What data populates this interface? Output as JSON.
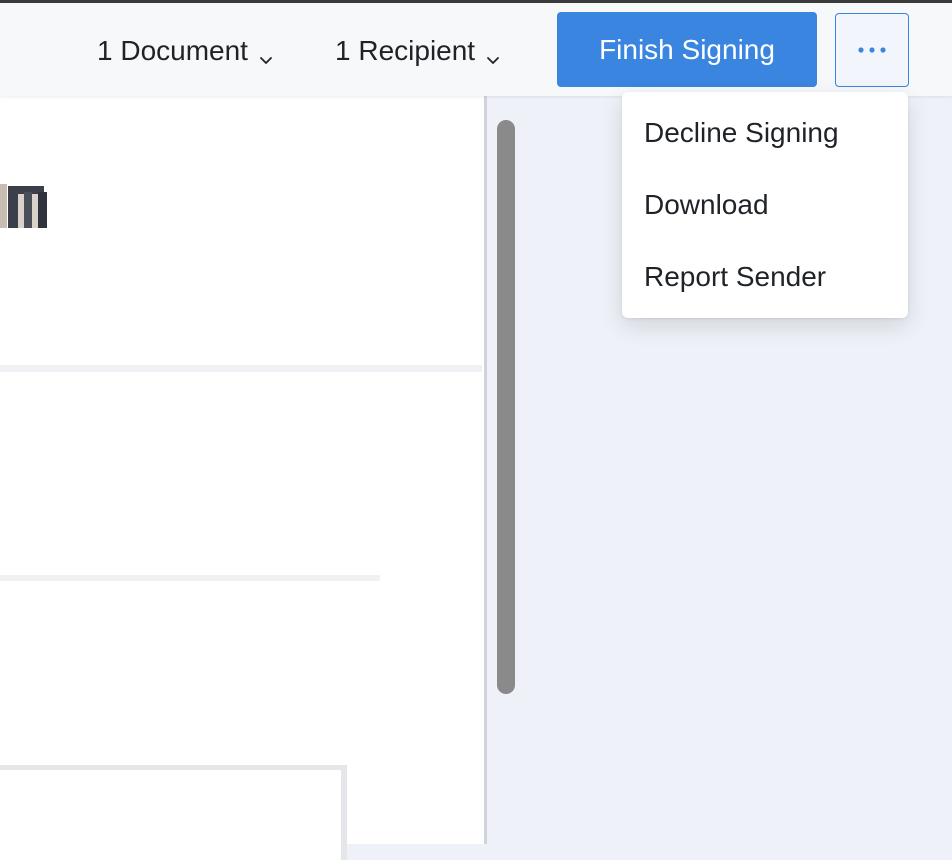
{
  "header": {
    "documents_label": "1 Document",
    "recipients_label": "1 Recipient",
    "finish_label": "Finish Signing",
    "more_icon": "ellipsis-icon",
    "chevron_icon": "chevron-down-icon"
  },
  "menu": {
    "items": [
      {
        "label": "Decline Signing"
      },
      {
        "label": "Download"
      },
      {
        "label": "Report Sender"
      }
    ]
  },
  "colors": {
    "accent": "#3a85e0",
    "header_bg": "#f7f8fa",
    "panel_bg": "#eef2f8",
    "scrollbar": "#8a8a8a"
  }
}
